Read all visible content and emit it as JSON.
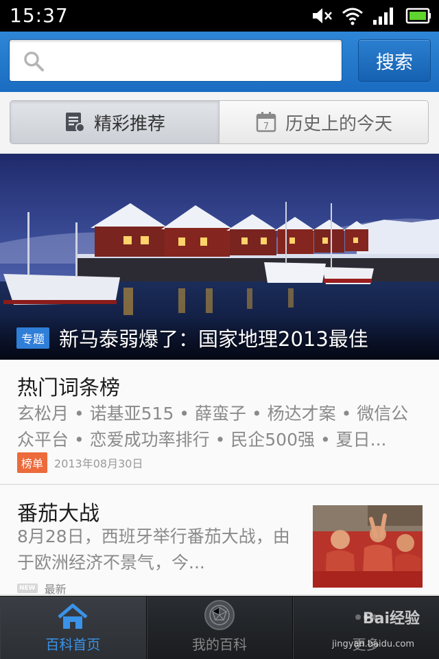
{
  "status_bar": {
    "time": "15:37",
    "icons": [
      "mute-icon",
      "wifi-icon",
      "signal-icon",
      "battery-icon"
    ]
  },
  "search": {
    "placeholder": "",
    "value": "",
    "button_label": "搜索"
  },
  "tabs": [
    {
      "label": "精彩推荐",
      "icon": "document-icon",
      "active": true
    },
    {
      "label": "历史上的今天",
      "icon": "calendar-icon",
      "calendar_day": "7",
      "active": false
    }
  ],
  "banner": {
    "tag": "专题",
    "title": "新马泰弱爆了：国家地理2013最佳"
  },
  "feed": [
    {
      "title": "热门词条榜",
      "description": "玄松月 • 诺基亚515 • 薛蛮子 • 杨达才案 • 微信公众平台 • 恋爱成功率排行 • 民企500强 • 夏日...",
      "badge": "榜单",
      "date": "2013年08月30日"
    },
    {
      "title": "番茄大战",
      "description": "8月28日，西班牙举行番茄大战，由于欧洲经济不景气，今...",
      "badge": "NEW",
      "meta": "最新"
    }
  ],
  "bottom_nav": [
    {
      "label": "百科首页",
      "icon": "home-icon",
      "active": true
    },
    {
      "label": "我的百科",
      "icon": "globe-icon",
      "active": false
    },
    {
      "label": "更多",
      "icon": "more-icon",
      "active": false
    }
  ],
  "watermark": {
    "logo": "Bai经验",
    "url": "jingyan.baidu.com"
  },
  "colors": {
    "header_blue": "#1a6cc0",
    "accent_blue": "#2f7ed8",
    "rank_orange": "#ec6a3b",
    "nav_active": "#3a93e8"
  }
}
